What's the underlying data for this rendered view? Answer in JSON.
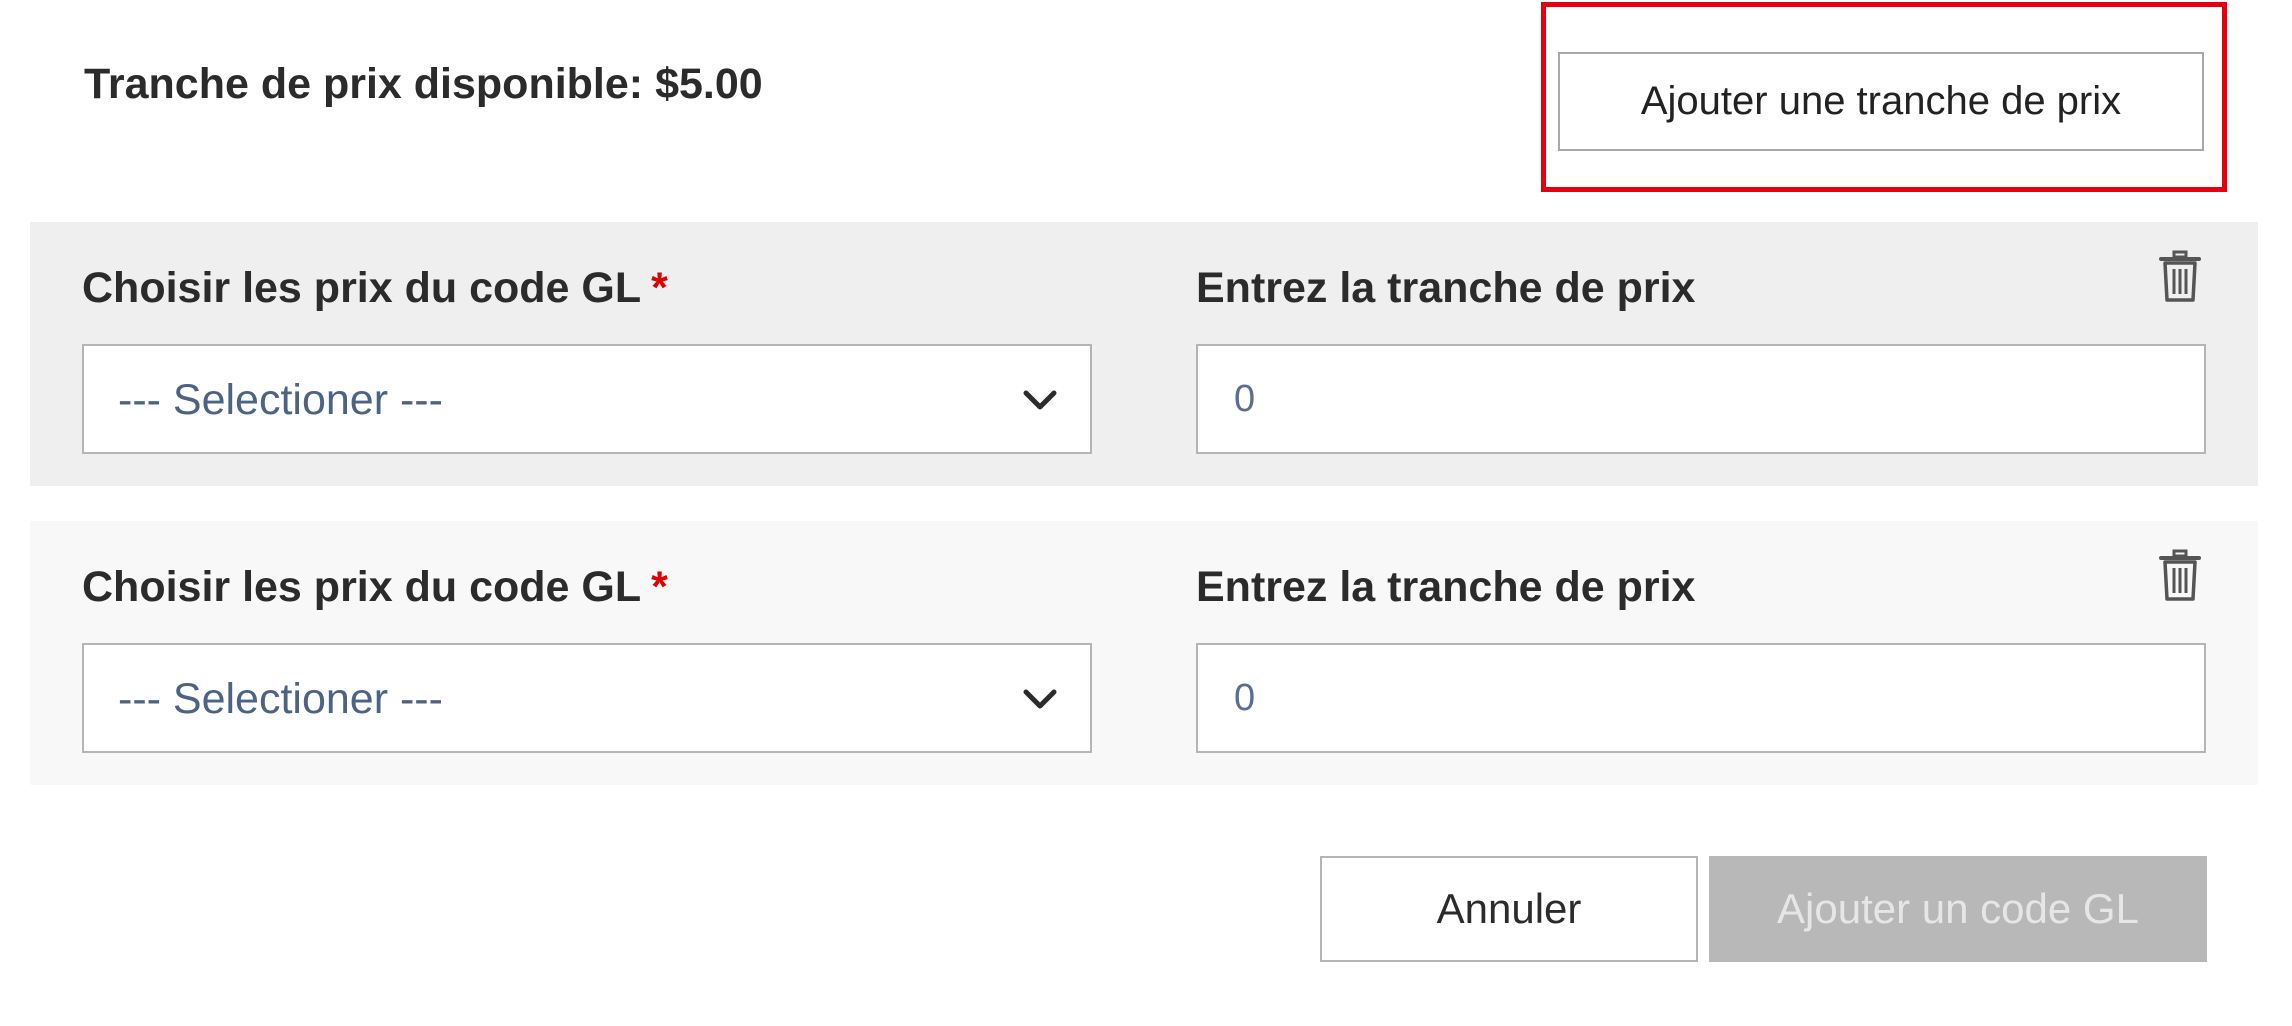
{
  "header": {
    "available_label": "Tranche de prix disponible:",
    "available_amount": "$5.00",
    "add_range_label": "Ajouter une tranche de prix"
  },
  "rows": [
    {
      "gl_label": "Choisir les prix du code GL",
      "required_mark": "*",
      "gl_select_value": "--- Selectioner ---",
      "range_label": "Entrez la tranche de prix",
      "range_placeholder": "0",
      "delete_icon": "trash-icon"
    },
    {
      "gl_label": "Choisir les prix du code GL",
      "required_mark": "*",
      "gl_select_value": "--- Selectioner ---",
      "range_label": "Entrez la tranche de prix",
      "range_placeholder": "0",
      "delete_icon": "trash-icon"
    }
  ],
  "footer": {
    "cancel_label": "Annuler",
    "add_gl_label": "Ajouter un code GL"
  },
  "colors": {
    "highlight": "#e3000f",
    "required": "#e00000",
    "disabled_button": "#b8b8b8",
    "select_text": "#4d6385"
  }
}
